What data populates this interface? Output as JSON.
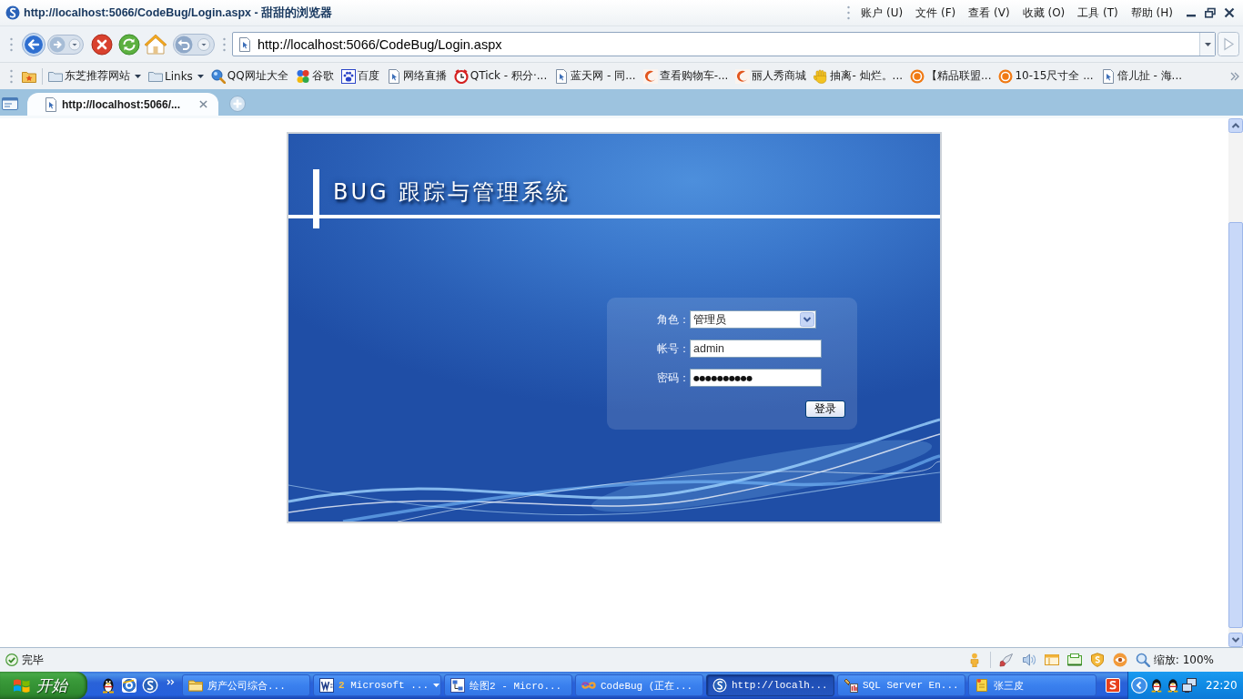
{
  "window": {
    "title": "http://localhost:5066/CodeBug/Login.aspx - 甜甜的浏览器",
    "menu": [
      "账户 (U)",
      "文件 (F)",
      "查看 (V)",
      "收藏 (O)",
      "工具 (T)",
      "帮助 (H)"
    ]
  },
  "address_bar": {
    "url": "http://localhost:5066/CodeBug/Login.aspx"
  },
  "bookmarks": [
    {
      "label": "东芝推荐网站",
      "kind": "folder"
    },
    {
      "label": "Links",
      "kind": "folder"
    },
    {
      "label": "QQ网址大全",
      "kind": "search"
    },
    {
      "label": "谷歌",
      "kind": "dots"
    },
    {
      "label": "百度",
      "kind": "paw"
    },
    {
      "label": "网络直播",
      "kind": "page"
    },
    {
      "label": "QTick - 积分·...",
      "kind": "clock"
    },
    {
      "label": "蓝天网 - 同...",
      "kind": "page"
    },
    {
      "label": "查看购物车-...",
      "kind": "swirl"
    },
    {
      "label": "丽人秀商城",
      "kind": "swirl"
    },
    {
      "label": "抽离- 灿烂。...",
      "kind": "hand"
    },
    {
      "label": "【精品联盟...",
      "kind": "badge"
    },
    {
      "label": "10-15尺寸全 ...",
      "kind": "badge"
    },
    {
      "label": "倍儿扯 - 海...",
      "kind": "page"
    }
  ],
  "tabs": [
    {
      "label": "http://localhost:5066/...",
      "selected": true
    }
  ],
  "login": {
    "title": "BUG 跟踪与管理系统",
    "fields": [
      {
        "kind": "select",
        "label": "角色：",
        "value": "管理员"
      },
      {
        "kind": "text",
        "label": "帐号：",
        "value": "admin"
      },
      {
        "kind": "password",
        "label": "密码：",
        "value": "●●●●●●●●●●"
      }
    ],
    "submit": "登录"
  },
  "status_bar": {
    "text": "完毕",
    "zoom": "缩放: 100%"
  },
  "taskbar": {
    "start": "开始",
    "tasks": [
      {
        "label": "房产公司综合...",
        "kind": "folder",
        "selected": false
      },
      {
        "label": "Microsoft ...",
        "count": "2",
        "kind": "word",
        "selected": false
      },
      {
        "label": "绘图2 - Micro...",
        "kind": "diagram",
        "selected": false
      },
      {
        "label": "CodeBug (正在...",
        "kind": "studio",
        "selected": false
      },
      {
        "label": "http://localh...",
        "kind": "browser",
        "selected": true
      },
      {
        "label": "SQL Server En...",
        "kind": "tools",
        "selected": false
      },
      {
        "label": "张三皮",
        "kind": "note",
        "selected": false
      }
    ],
    "clock": "22:20"
  }
}
